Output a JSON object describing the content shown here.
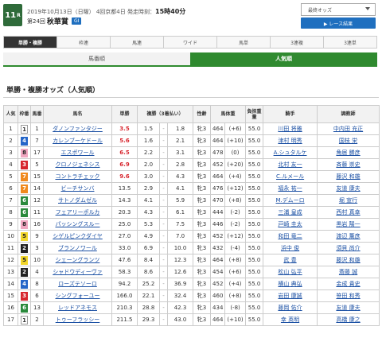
{
  "race": {
    "number": "11",
    "suffix": "R",
    "date_line": "2019年10月13日（日曜） 4回京都4日 発走時刻：",
    "post_time": "15時40分",
    "nth": "第24回",
    "name": "秋華賞",
    "grade": "GI"
  },
  "header": {
    "odds_select": "最終オッズ",
    "result_button": "▶ レース結果"
  },
  "bet_tabs": [
    "単勝・複勝",
    "枠連",
    "馬連",
    "ワイド",
    "馬単",
    "3連複",
    "3連単"
  ],
  "sort_tabs": [
    "馬番順",
    "人気順"
  ],
  "section_title": "単勝・複勝オッズ（人気順）",
  "table": {
    "headers": [
      "人気",
      "枠番",
      "馬番",
      "馬名",
      "単勝",
      "複勝（3着払い）",
      "",
      "",
      "性齢",
      "馬体重",
      "",
      "負担重量",
      "騎手",
      "調教師"
    ],
    "rows": [
      {
        "pop": "1",
        "waku": "1",
        "uma": "1",
        "name": "ダノンファンタジー",
        "win": "3.5",
        "plo": "1.5",
        "plh": "1.8",
        "sex": "牝3",
        "wt": "464",
        "wd": "(+6)",
        "kg": "55.0",
        "jockey": "川田 将雅",
        "trainer": "中内田 充正",
        "hot": true
      },
      {
        "pop": "2",
        "waku": "4",
        "uma": "7",
        "name": "カレンブーケドール",
        "win": "5.6",
        "plo": "1.6",
        "plh": "2.1",
        "sex": "牝3",
        "wt": "464",
        "wd": "(+10)",
        "kg": "55.0",
        "jockey": "津村 明秀",
        "trainer": "国枝 栄",
        "hot": true
      },
      {
        "pop": "3",
        "waku": "8",
        "uma": "17",
        "name": "エスポワール",
        "win": "6.5",
        "plo": "2.2",
        "plh": "3.1",
        "sex": "牝3",
        "wt": "478",
        "wd": "(0)",
        "kg": "55.0",
        "jockey": "A.シュタルケ",
        "trainer": "角居 勝彦",
        "hot": true
      },
      {
        "pop": "4",
        "waku": "3",
        "uma": "5",
        "name": "クロノジェネシス",
        "win": "6.9",
        "plo": "2.0",
        "plh": "2.8",
        "sex": "牝3",
        "wt": "452",
        "wd": "(+20)",
        "kg": "55.0",
        "jockey": "北村 友一",
        "trainer": "斉藤 崇史",
        "hot": true
      },
      {
        "pop": "5",
        "waku": "7",
        "uma": "15",
        "name": "コントラチェック",
        "win": "9.6",
        "plo": "3.0",
        "plh": "4.3",
        "sex": "牝3",
        "wt": "464",
        "wd": "(+4)",
        "kg": "55.0",
        "jockey": "C.ルメール",
        "trainer": "藤沢 和雄",
        "hot": true
      },
      {
        "pop": "6",
        "waku": "7",
        "uma": "14",
        "name": "ビーチサンバ",
        "win": "13.5",
        "plo": "2.9",
        "plh": "4.1",
        "sex": "牝3",
        "wt": "476",
        "wd": "(+12)",
        "kg": "55.0",
        "jockey": "福永 祐一",
        "trainer": "友道 康夫",
        "hot": false
      },
      {
        "pop": "7",
        "waku": "6",
        "uma": "12",
        "name": "サトノダムゼル",
        "win": "14.3",
        "plo": "4.1",
        "plh": "5.9",
        "sex": "牝3",
        "wt": "470",
        "wd": "(+8)",
        "kg": "55.0",
        "jockey": "M.デムーロ",
        "trainer": "堀 宣行",
        "hot": false
      },
      {
        "pop": "8",
        "waku": "6",
        "uma": "11",
        "name": "フェアリーポルカ",
        "win": "20.3",
        "plo": "4.3",
        "plh": "6.1",
        "sex": "牝3",
        "wt": "444",
        "wd": "(-2)",
        "kg": "55.0",
        "jockey": "三浦 皇成",
        "trainer": "西村 真幸",
        "hot": false
      },
      {
        "pop": "9",
        "waku": "8",
        "uma": "16",
        "name": "パッシングスルー",
        "win": "25.0",
        "plo": "5.3",
        "plh": "7.5",
        "sex": "牝3",
        "wt": "446",
        "wd": "(-2)",
        "kg": "55.0",
        "jockey": "戸崎 圭太",
        "trainer": "黒岩 陽一",
        "hot": false
      },
      {
        "pop": "10",
        "waku": "5",
        "uma": "9",
        "name": "シゲルピンクダイヤ",
        "win": "27.0",
        "plo": "4.9",
        "plh": "7.0",
        "sex": "牝3",
        "wt": "452",
        "wd": "(+12)",
        "kg": "55.0",
        "jockey": "和田 竜二",
        "trainer": "渡辺 薫彦",
        "hot": false
      },
      {
        "pop": "11",
        "waku": "2",
        "uma": "3",
        "name": "ブランノワール",
        "win": "33.0",
        "plo": "6.9",
        "plh": "10.0",
        "sex": "牝3",
        "wt": "432",
        "wd": "(-4)",
        "kg": "55.0",
        "jockey": "浜中 俊",
        "trainer": "須貝 尚介",
        "hot": false
      },
      {
        "pop": "12",
        "waku": "5",
        "uma": "10",
        "name": "シェーングランツ",
        "win": "47.6",
        "plo": "8.4",
        "plh": "12.3",
        "sex": "牝3",
        "wt": "464",
        "wd": "(+8)",
        "kg": "55.0",
        "jockey": "武 豊",
        "trainer": "藤沢 和雄",
        "hot": false
      },
      {
        "pop": "13",
        "waku": "2",
        "uma": "4",
        "name": "シャドウディーヴァ",
        "win": "58.3",
        "plo": "8.6",
        "plh": "12.6",
        "sex": "牝3",
        "wt": "454",
        "wd": "(+6)",
        "kg": "55.0",
        "jockey": "松山 弘平",
        "trainer": "斎藤 誠",
        "hot": false
      },
      {
        "pop": "14",
        "waku": "4",
        "uma": "8",
        "name": "ローズテソーロ",
        "win": "94.2",
        "plo": "25.2",
        "plh": "36.9",
        "sex": "牝3",
        "wt": "452",
        "wd": "(+4)",
        "kg": "55.0",
        "jockey": "横山 典弘",
        "trainer": "金成 貴史",
        "hot": false
      },
      {
        "pop": "15",
        "waku": "3",
        "uma": "6",
        "name": "シングフォーユー",
        "win": "166.0",
        "plo": "22.1",
        "plh": "32.4",
        "sex": "牝3",
        "wt": "460",
        "wd": "(+8)",
        "kg": "55.0",
        "jockey": "岩田 康誠",
        "trainer": "笹田 和秀",
        "hot": false
      },
      {
        "pop": "16",
        "waku": "6",
        "uma": "13",
        "name": "レッドアネモス",
        "win": "210.3",
        "plo": "28.8",
        "plh": "42.3",
        "sex": "牝3",
        "wt": "434",
        "wd": "(-8)",
        "kg": "55.0",
        "jockey": "藤岡 佑介",
        "trainer": "友道 康夫",
        "hot": false
      },
      {
        "pop": "17",
        "waku": "1",
        "uma": "2",
        "name": "トゥーフラッシー",
        "win": "211.5",
        "plo": "29.3",
        "plh": "43.0",
        "sex": "牝3",
        "wt": "464",
        "wd": "(+10)",
        "kg": "55.0",
        "jockey": "幸 英明",
        "trainer": "高橋 康之",
        "hot": false
      }
    ]
  },
  "colors": {
    "accent_green": "#2f8a2f",
    "race_badge": "#2f6b3a",
    "button_blue": "#1f6fbf",
    "odds_red": "#d7262e"
  }
}
